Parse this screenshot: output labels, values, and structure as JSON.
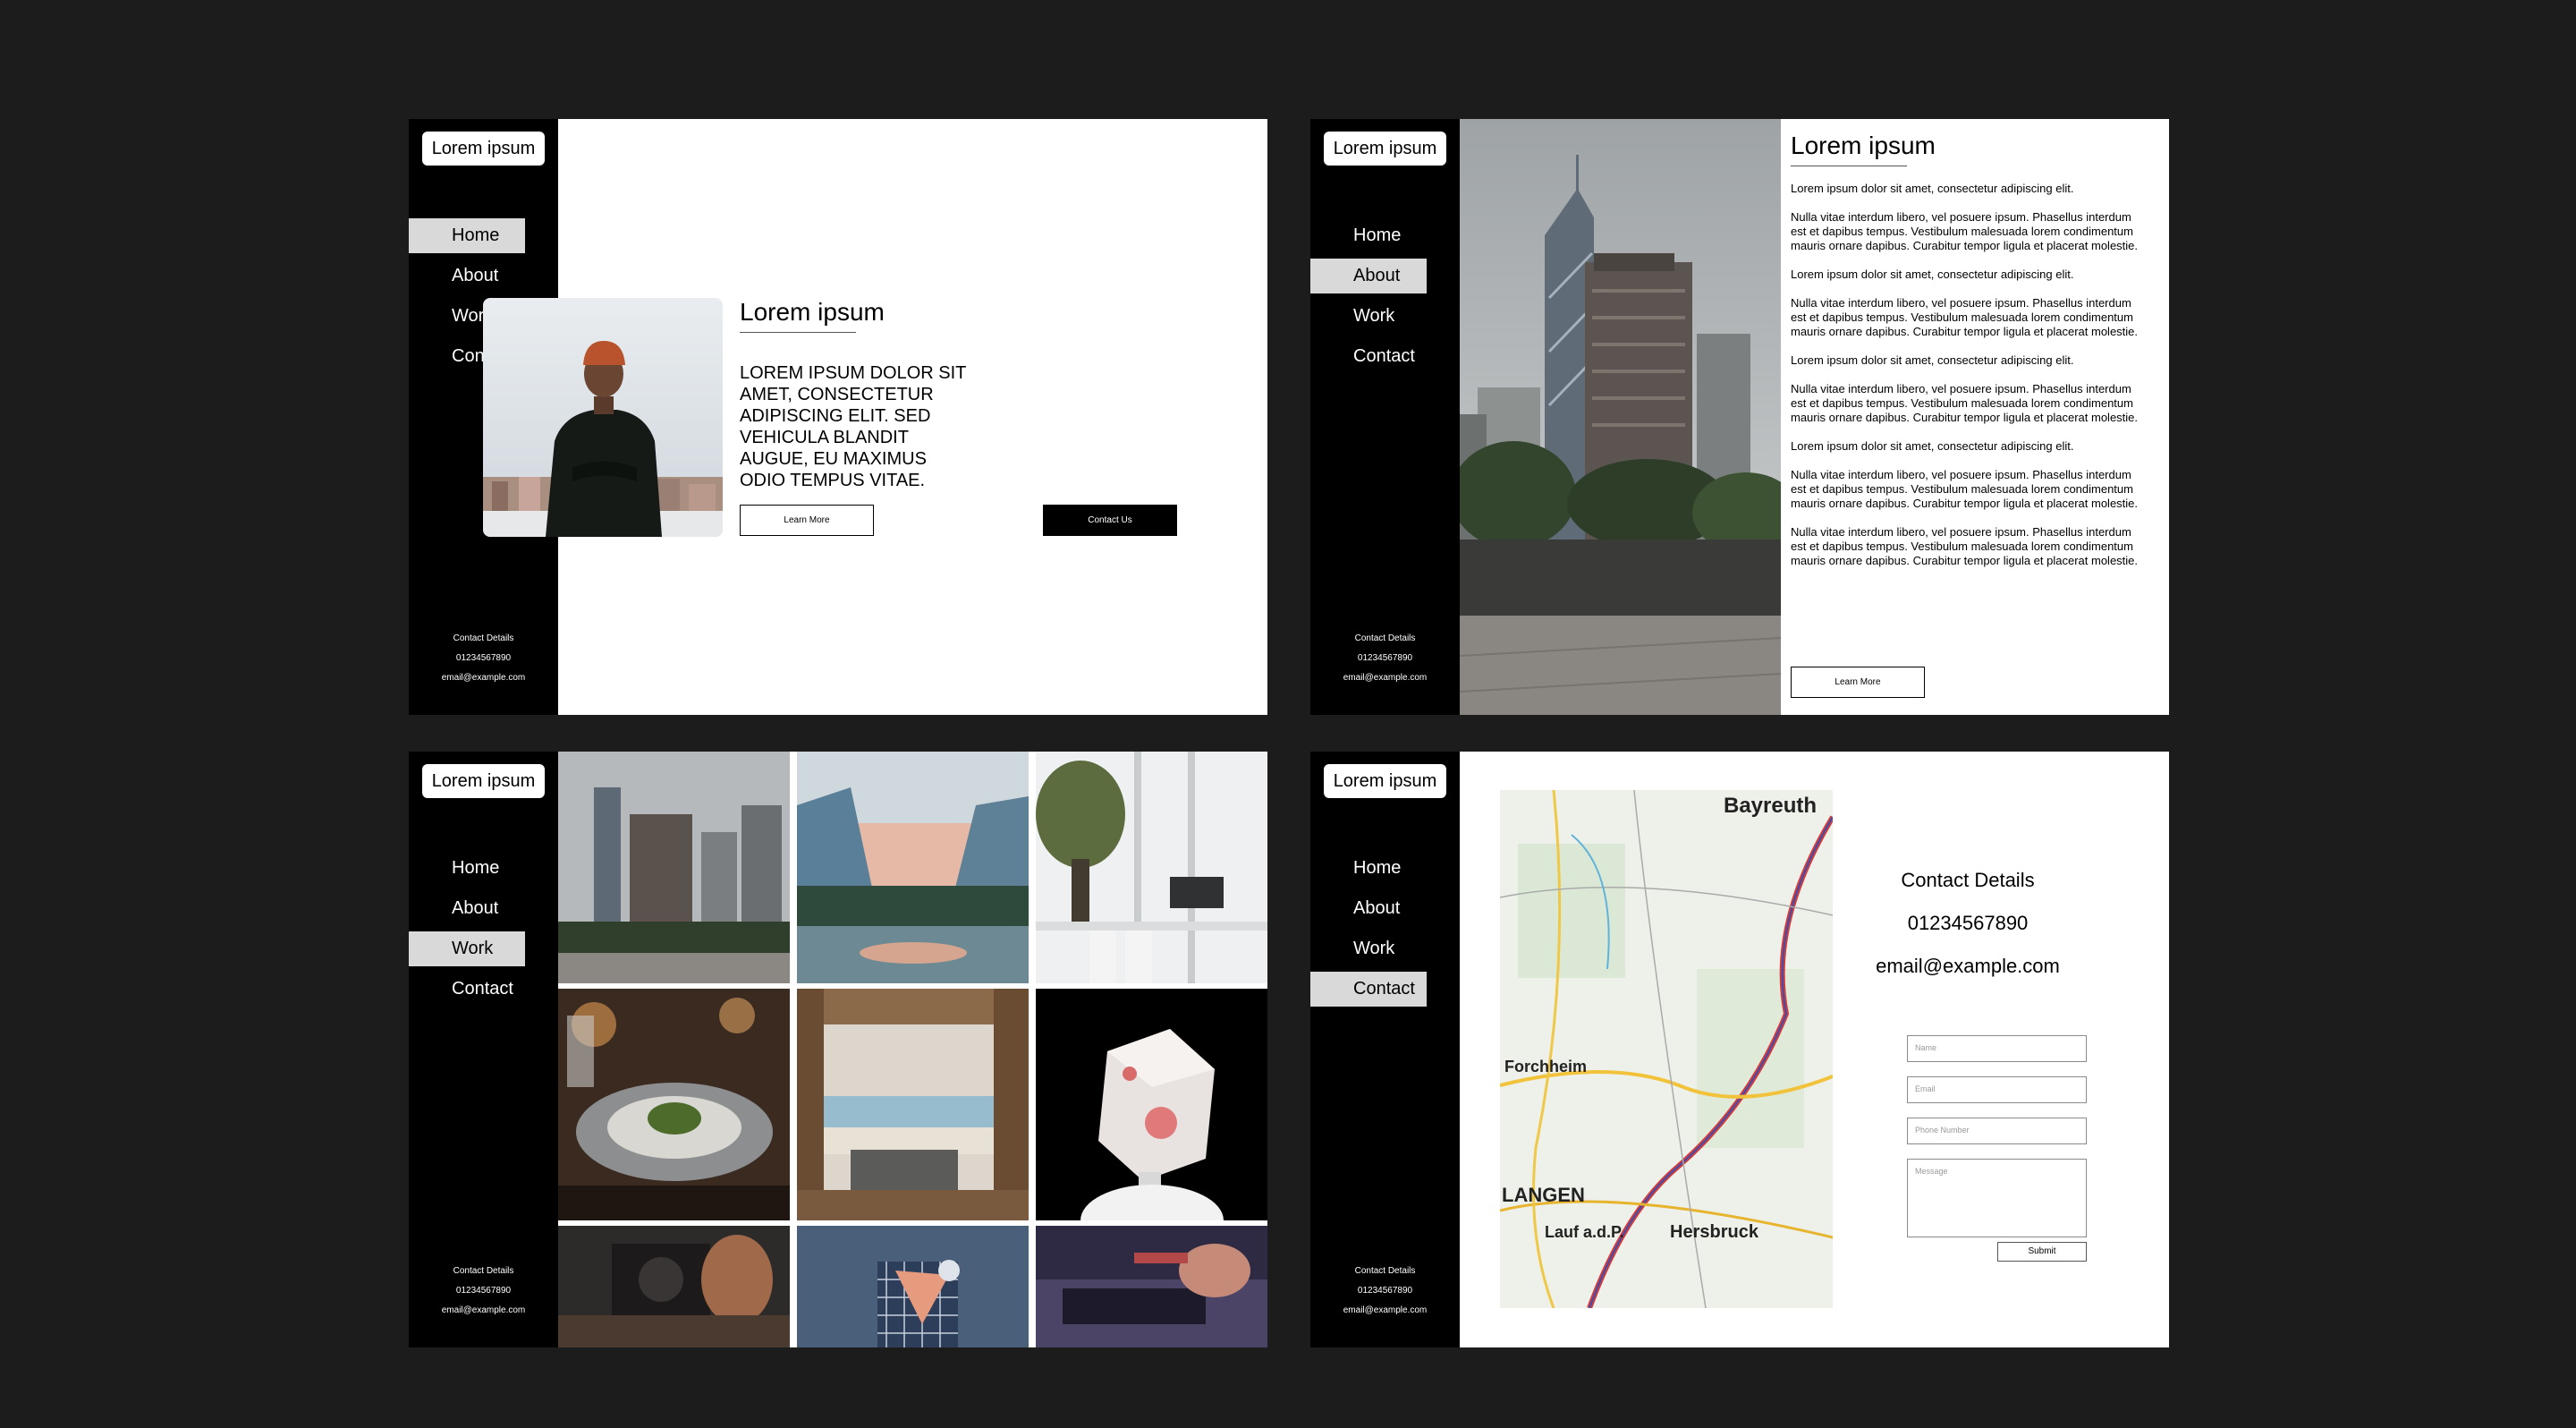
{
  "logo_text": "Lorem ipsum",
  "nav": [
    "Home",
    "About",
    "Work",
    "Contact"
  ],
  "sidebar_contact": {
    "heading": "Contact Details",
    "phone": "01234567890",
    "email": "email@example.com"
  },
  "home": {
    "title": "Lorem ipsum",
    "text_lines": [
      "LOREM IPSUM DOLOR SIT",
      "AMET, CONSECTETUR",
      "ADIPISCING ELIT. SED",
      "VEHICULA BLANDIT",
      "AUGUE, EU MAXIMUS",
      "ODIO TEMPUS VITAE."
    ],
    "learn_more": "Learn More",
    "contact_us": "Contact Us"
  },
  "about": {
    "title": "Lorem ipsum",
    "paragraphs": [
      "Lorem ipsum dolor sit amet, consectetur adipiscing elit.",
      "Nulla vitae interdum libero, vel posuere ipsum. Phasellus interdum est et dapibus tempus. Vestibulum malesuada lorem condimentum mauris ornare dapibus. Curabitur tempor ligula et placerat molestie.",
      "Lorem ipsum dolor sit amet, consectetur adipiscing elit.",
      "Nulla vitae interdum libero, vel posuere ipsum. Phasellus interdum est et dapibus tempus. Vestibulum malesuada lorem condimentum mauris ornare dapibus. Curabitur tempor ligula et placerat molestie.",
      "Lorem ipsum dolor sit amet, consectetur adipiscing elit.",
      "Nulla vitae interdum libero, vel posuere ipsum. Phasellus interdum est et dapibus tempus. Vestibulum malesuada lorem condimentum mauris ornare dapibus. Curabitur tempor ligula et placerat molestie.",
      "Lorem ipsum dolor sit amet, consectetur adipiscing elit.",
      "Nulla vitae interdum libero, vel posuere ipsum. Phasellus interdum est et dapibus tempus. Vestibulum malesuada lorem condimentum mauris ornare dapibus. Curabitur tempor ligula et placerat molestie.",
      "Nulla vitae interdum libero, vel posuere ipsum. Phasellus interdum est et dapibus tempus. Vestibulum malesuada lorem condimentum mauris ornare dapibus. Curabitur tempor ligula et placerat molestie."
    ],
    "learn_more": "Learn More"
  },
  "contact": {
    "heading": "Contact Details",
    "phone": "01234567890",
    "email": "email@example.com",
    "form": {
      "name_placeholder": "Name",
      "email_placeholder": "Email",
      "phone_placeholder": "Phone Number",
      "message_placeholder": "Message",
      "submit": "Submit"
    },
    "map_labels": [
      "Bayreuth",
      "Forchheim",
      "LANGEN",
      "Hersbruck",
      "Lauf a.d.P."
    ]
  },
  "colors": {
    "page_bg": "#1c1c1c",
    "sidebar_bg": "#000000",
    "active_nav_bg": "#d9d9d9",
    "content_bg": "#ffffff"
  }
}
